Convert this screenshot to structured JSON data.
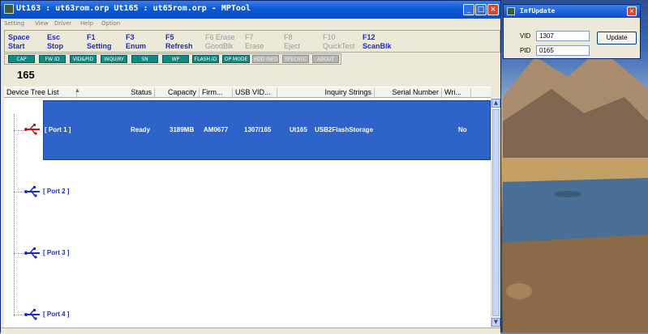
{
  "window": {
    "title": "Ut163 : ut63rom.orp Ut165 : ut65rom.orp  - MPTool",
    "min_label": "_",
    "max_label": "□",
    "close_label": "×"
  },
  "menu": [
    "Setting",
    "View",
    "Driver",
    "Help",
    "Option"
  ],
  "hotkeys": [
    {
      "key": "Space",
      "action": "Start",
      "enabled": true
    },
    {
      "key": "Esc",
      "action": "Stop",
      "enabled": true
    },
    {
      "key": "F1",
      "action": "Setting",
      "enabled": true
    },
    {
      "key": "F3",
      "action": "Enum",
      "enabled": true
    },
    {
      "key": "F5",
      "action": "Refresh",
      "enabled": true
    },
    {
      "key": "F6 Erase",
      "action": "GoodBlk",
      "enabled": false
    },
    {
      "key": "F7",
      "action": "Erase",
      "enabled": false
    },
    {
      "key": "F8",
      "action": "Eject",
      "enabled": false
    },
    {
      "key": "F10",
      "action": "QuickTest",
      "enabled": false
    },
    {
      "key": "F12",
      "action": "ScanBlk",
      "enabled": true
    }
  ],
  "toolbar": [
    {
      "label": "CAP",
      "enabled": true
    },
    {
      "label": "FW ID",
      "enabled": true
    },
    {
      "label": "VID&PID",
      "enabled": true
    },
    {
      "label": "INQUIRY",
      "enabled": true
    },
    {
      "label": "SN",
      "enabled": true
    },
    {
      "label": "WP",
      "enabled": true
    },
    {
      "label": "FLASH ID",
      "enabled": true
    },
    {
      "label": "OP MODE",
      "enabled": true
    },
    {
      "label": "HDD INFO",
      "enabled": false
    },
    {
      "label": "SPECIFIC",
      "enabled": false
    },
    {
      "label": "ABOUT",
      "enabled": false
    }
  ],
  "device_count": "165",
  "columns": [
    "Device Tree List",
    "▲",
    "Status",
    "Capacity",
    "Firm...",
    "USB VID...",
    "Inquiry Strings",
    "Serial Number",
    "Wri..."
  ],
  "rows": [
    {
      "port": "[ Port 1 ]",
      "status": "Ready",
      "capacity": "3189MB",
      "firmware": "AM0677",
      "vidpid": "1307/165",
      "inq1": "Ut165",
      "inq2": "USB2FlashStorage",
      "serial": "",
      "write": "No",
      "selected": true
    },
    {
      "port": "[ Port 2 ]",
      "selected": false
    },
    {
      "port": "[ Port 3 ]",
      "selected": false
    },
    {
      "port": "[ Port 4 ]",
      "selected": false
    }
  ],
  "scroll": {
    "up": "▲",
    "down": "▼"
  },
  "dialog": {
    "title": "InfUpdate",
    "close_label": "×",
    "vid_label": "VID",
    "vid_value": "1307",
    "pid_label": "PID",
    "pid_value": "0165",
    "update_label": "Update"
  },
  "colors": {
    "accent": "#0a4cc8",
    "selection": "#2e63c9",
    "hotkey": "#1a2bc8",
    "toolbar_btn": "#0d8a84"
  }
}
